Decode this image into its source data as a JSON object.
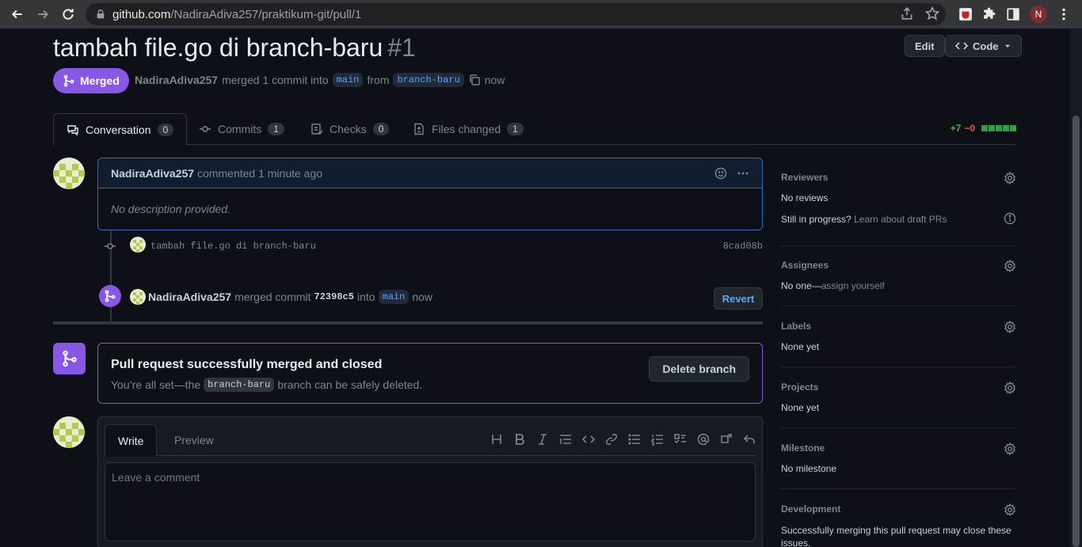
{
  "browser": {
    "url_host": "github.com",
    "url_path": "/NadiraAdiva257/praktikum-git/pull/1",
    "profile_initial": "N"
  },
  "pr": {
    "title": "tambah file.go di branch-baru",
    "number": "#1",
    "edit_label": "Edit",
    "code_label": "Code",
    "status_label": "Merged",
    "author": "NadiraAdiva257",
    "meta_action": "merged 1 commit into",
    "base_branch": "main",
    "meta_from": "from",
    "head_branch": "branch-baru",
    "meta_time": "now"
  },
  "tabs": [
    {
      "label": "Conversation",
      "count": "0"
    },
    {
      "label": "Commits",
      "count": "1"
    },
    {
      "label": "Checks",
      "count": "0"
    },
    {
      "label": "Files changed",
      "count": "1"
    }
  ],
  "diffstat": {
    "additions": "+7",
    "deletions": "−0"
  },
  "comment": {
    "author": "NadiraAdiva257",
    "action": "commented 1 minute ago",
    "body": "No description provided."
  },
  "commit": {
    "message": "tambah file.go di branch-baru",
    "sha": "8cad08b"
  },
  "merge_event": {
    "author": "NadiraAdiva257",
    "action": "merged commit",
    "sha": "72398c5",
    "into": "into",
    "branch": "main",
    "time": "now",
    "revert_label": "Revert"
  },
  "merged_box": {
    "title": "Pull request successfully merged and closed",
    "desc_before": "You’re all set—the",
    "branch": "branch-baru",
    "desc_after": "branch can be safely deleted.",
    "delete_label": "Delete branch"
  },
  "editor": {
    "write_tab": "Write",
    "preview_tab": "Preview",
    "placeholder": "Leave a comment"
  },
  "sidebar": {
    "reviewers": {
      "title": "Reviewers",
      "value": "No reviews",
      "draft_text": "Still in progress?",
      "draft_link": "Learn about draft PRs"
    },
    "assignees": {
      "title": "Assignees",
      "value": "No one—",
      "link": "assign yourself"
    },
    "labels": {
      "title": "Labels",
      "value": "None yet"
    },
    "projects": {
      "title": "Projects",
      "value": "None yet"
    },
    "milestone": {
      "title": "Milestone",
      "value": "No milestone"
    },
    "development": {
      "title": "Development",
      "value": "Successfully merging this pull request may close these issues."
    }
  }
}
